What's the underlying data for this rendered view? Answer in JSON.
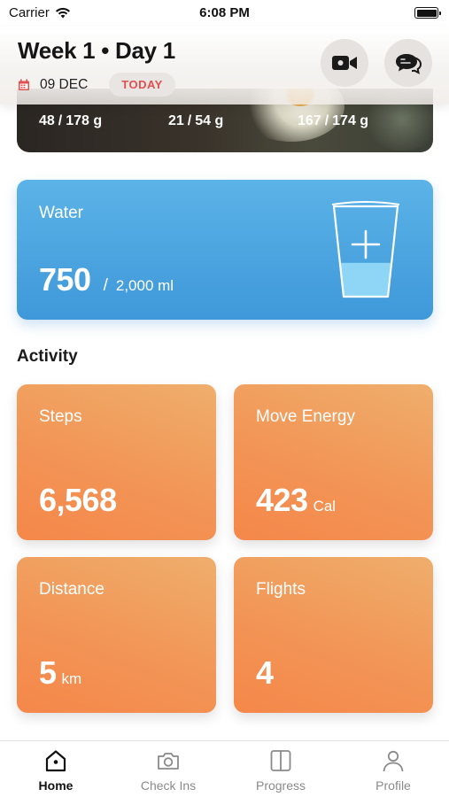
{
  "status_bar": {
    "carrier": "Carrier",
    "time": "6:08 PM"
  },
  "header": {
    "title": "Week 1 • Day 1",
    "date": "09 DEC",
    "today_label": "TODAY",
    "video_icon": "video-camera-icon",
    "chat_icon": "chat-bubbles-icon"
  },
  "meal": {
    "macros": [
      {
        "current": "48",
        "total": "178 g"
      },
      {
        "current": "21",
        "total": "54 g"
      },
      {
        "current": "167",
        "total": "174 g"
      }
    ]
  },
  "water": {
    "label": "Water",
    "current": "750",
    "separator": "/",
    "goal": "2,000 ml",
    "fill_fraction": 0.375,
    "icon": "water-glass-plus-icon"
  },
  "activity": {
    "heading": "Activity",
    "steps": {
      "label": "Steps",
      "value": "6,568",
      "unit": ""
    },
    "move_energy": {
      "label": "Move Energy",
      "value": "423",
      "unit": "Cal"
    },
    "distance": {
      "label": "Distance",
      "value": "5",
      "unit": "km"
    },
    "flights": {
      "label": "Flights",
      "value": "4",
      "unit": ""
    }
  },
  "tabs": [
    {
      "label": "Home",
      "icon": "home-icon",
      "active": true
    },
    {
      "label": "Check Ins",
      "icon": "camera-icon",
      "active": false
    },
    {
      "label": "Progress",
      "icon": "progress-book-icon",
      "active": false
    },
    {
      "label": "Profile",
      "icon": "profile-icon",
      "active": false
    }
  ],
  "colors": {
    "water_card": "#4aa5e0",
    "activity_card": "#f29556",
    "today_text": "#e0504f"
  }
}
